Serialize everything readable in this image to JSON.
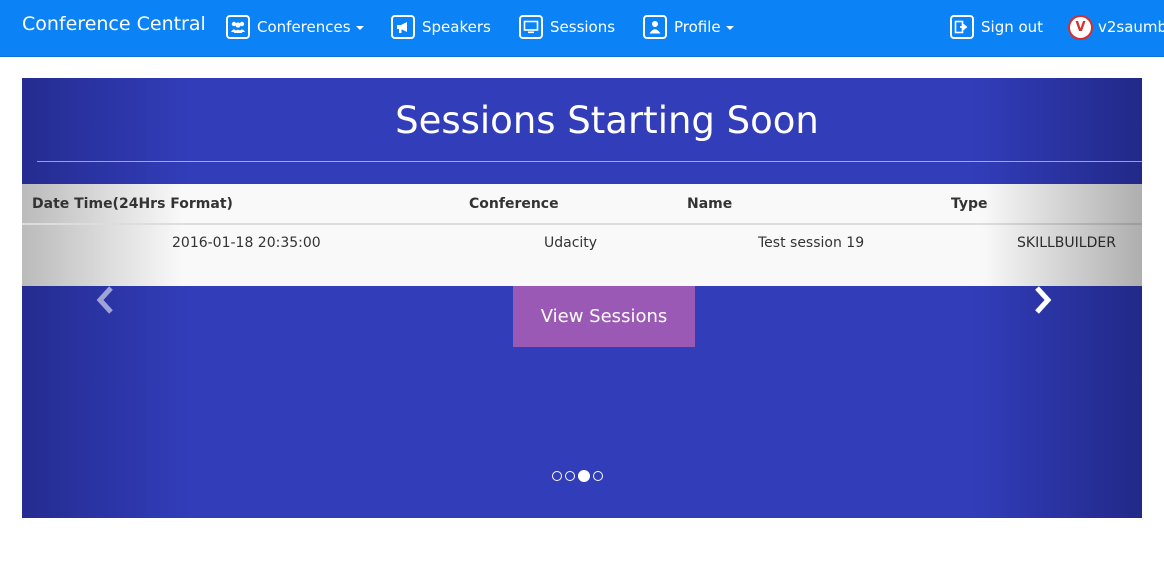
{
  "navbar": {
    "brand": "Conference Central",
    "items": [
      {
        "label": "Conferences",
        "icon": "users-icon",
        "dropdown": true
      },
      {
        "label": "Speakers",
        "icon": "megaphone-icon",
        "dropdown": false
      },
      {
        "label": "Sessions",
        "icon": "monitor-icon",
        "dropdown": false
      },
      {
        "label": "Profile",
        "icon": "user-icon",
        "dropdown": true
      }
    ],
    "sign_out": {
      "label": "Sign out",
      "icon": "sign-out-icon"
    },
    "user": {
      "avatar_letter": "V",
      "name": "v2saumb"
    }
  },
  "carousel": {
    "heading": "Sessions Starting Soon",
    "table": {
      "headers": [
        "Date Time(24Hrs Format)",
        "Conference",
        "Name",
        "Type"
      ],
      "rows": [
        [
          "2016-01-18 20:35:00",
          "Udacity",
          "Test session 19",
          "SKILLBUILDER"
        ]
      ]
    },
    "button_label": "View Sessions",
    "indicators": {
      "count": 4,
      "active_index": 2
    }
  },
  "colors": {
    "navbar": "#0b83f6",
    "carousel_bg": "#323dba",
    "button": "#9b59b6"
  }
}
